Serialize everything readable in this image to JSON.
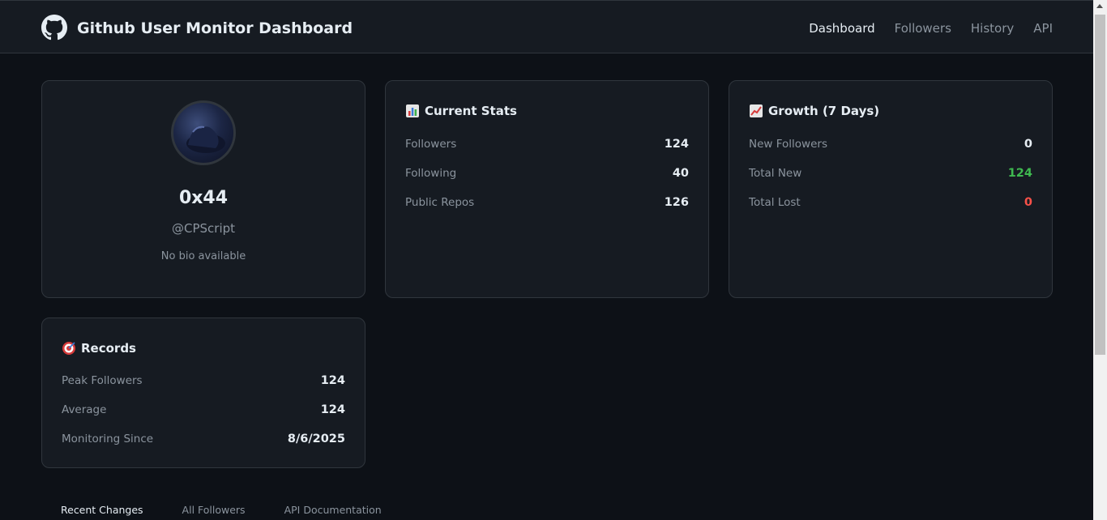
{
  "header": {
    "title": "Github User Monitor Dashboard",
    "nav": [
      "Dashboard",
      "Followers",
      "History",
      "API"
    ]
  },
  "profile": {
    "display_name": "0x44",
    "username": "@CPScript",
    "bio": "No bio available"
  },
  "current_stats": {
    "title": "Current Stats",
    "rows": [
      {
        "label": "Followers",
        "value": "124"
      },
      {
        "label": "Following",
        "value": "40"
      },
      {
        "label": "Public Repos",
        "value": "126"
      }
    ]
  },
  "growth": {
    "title": "Growth (7 Days)",
    "rows": [
      {
        "label": "New Followers",
        "value": "0"
      },
      {
        "label": "Total New",
        "value": "124"
      },
      {
        "label": "Total Lost",
        "value": "0"
      }
    ]
  },
  "records": {
    "title": "Records",
    "rows": [
      {
        "label": "Peak Followers",
        "value": "124"
      },
      {
        "label": "Average",
        "value": "124"
      },
      {
        "label": "Monitoring Since",
        "value": "8/6/2025"
      }
    ]
  },
  "tabs": [
    "Recent Changes",
    "All Followers",
    "API Documentation"
  ],
  "colors": {
    "positive": "#3fb950",
    "negative": "#f85149",
    "background": "#0d1117",
    "card": "#161b22"
  },
  "icons": {
    "logo": "github-icon",
    "current_stats": "bar-chart-icon",
    "growth": "chart-increasing-icon",
    "records": "target-icon"
  }
}
